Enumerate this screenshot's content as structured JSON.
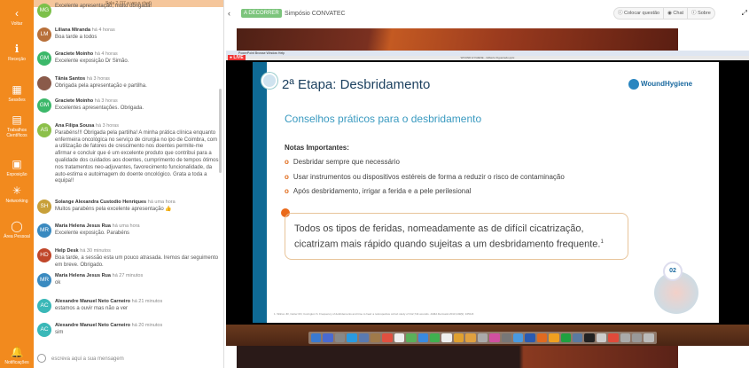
{
  "sidebar": {
    "items": [
      {
        "label": "Voltar",
        "icon": "chevron-left-icon"
      },
      {
        "label": "Receção",
        "icon": "info-icon"
      },
      {
        "label": "Sessões",
        "icon": "calendar-icon"
      },
      {
        "label": "Trabalhos Científicos",
        "icon": "documents-icon"
      },
      {
        "label": "Exposição",
        "icon": "booth-icon"
      },
      {
        "label": "Networking",
        "icon": "network-icon"
      },
      {
        "label": "Área Pessoal",
        "icon": "user-icon"
      },
      {
        "label": "Notificações",
        "icon": "bell-icon"
      }
    ]
  },
  "chat": {
    "room": "Sala 2 (37 a ver o chat)",
    "input_placeholder": "escreva aqui a sua mensagem",
    "messages": [
      {
        "initials": "MG",
        "name": "",
        "time": "",
        "text": "Excelente apresentação, muito obrigada!",
        "color": "#7cc04a"
      },
      {
        "initials": "LM",
        "name": "Liliana Miranda",
        "time": "há 4 horas",
        "text": "Boa tarde a todos",
        "color": "#b8703a"
      },
      {
        "initials": "GM",
        "name": "Graciete Moinho",
        "time": "há 4 horas",
        "text": "Excelente exposição Dr Simão.",
        "color": "#3cb86a"
      },
      {
        "initials": "",
        "name": "Tânia Santos",
        "time": "há 3 horas",
        "text": "Obrigada pela apresentação e partilha.",
        "color": "#8a5a4a"
      },
      {
        "initials": "GM",
        "name": "Graciete Moinho",
        "time": "há 3 horas",
        "text": "Excelentes apresentações. Obrigada.",
        "color": "#3cb86a"
      },
      {
        "initials": "AS",
        "name": "Ana Filipa Sousa",
        "time": "há 3 horas",
        "text": "Parabéns!!! Obrigada pela partilha! A minha prática clínica enquanto enfermeira oncológica no serviço de cirurgia no ipo de Coimbra, com a utilização de fatores de crescimento nos doentes permite-me afirmar e concluir que é um excelente produto que contribui para a qualidade dos cuidados aos doentes, cumprimento de tempos ótimos nos tratamentos neo-adjuvantes, favorecimento funcionalidade, da auto-estima e autoimagem do doente oncológico. Grata a toda a equipa!!",
        "color": "#8cc04a"
      },
      {
        "initials": "SH",
        "name": "Solange Alexandra Custodio Henriques",
        "time": "há uma hora",
        "text": "Muitos parabéns pela excelente apresentação 👍",
        "color": "#c8a03a"
      },
      {
        "initials": "MR",
        "name": "Maria Helena Jesus Rua",
        "time": "há uma hora",
        "text": "Excelente exposição. Parabéns",
        "color": "#3a8ac0"
      },
      {
        "initials": "HD",
        "name": "Help Desk",
        "time": "há 30 minutos",
        "text": "Boa tarde, a sessão esta um pouco atrasada. Iremos dar seguimento em breve. Obrigado.",
        "color": "#c0462a"
      },
      {
        "initials": "MR",
        "name": "Maria Helena Jesus Rua",
        "time": "há 27 minutos",
        "text": "ok",
        "color": "#3a8ac0"
      },
      {
        "initials": "AC",
        "name": "Alexandre Manuel Neto Carneiro",
        "time": "há 21 minutos",
        "text": "estamos a ouvir mas não a ver",
        "color": "#3ab8b8"
      },
      {
        "initials": "AC",
        "name": "Alexandre Manuel Neto Carneiro",
        "time": "há 20 minutos",
        "text": "sim",
        "color": "#3ab8b8"
      }
    ]
  },
  "header": {
    "status": "A DECORRER",
    "title": "Simpósio CONVATEC",
    "actions": [
      "Colocar questão",
      "Chat",
      "Sobre"
    ]
  },
  "stream": {
    "live": "LIVE",
    "menubar": "PowerPoint   Browse   Window   Help",
    "window_title": "WOUND HYGIENE - Gilberto Figueiredo.pptx",
    "slide": {
      "title": "2ª Etapa: Desbridamento",
      "logo": "WoundHygiene",
      "subtitle": "Conselhos práticos para o desbridamento",
      "notes_heading": "Notas Importantes:",
      "bullets": [
        "Desbridar sempre que necessário",
        "Usar instrumentos ou dispositivos estéreis de forma a reduzir o risco de contaminação",
        "Após desbridamento, irrigar a ferida e a pele perilesional"
      ],
      "callout": "Todos os tipos de feridas, nomeadamente as de difícil cicatrização, cicatrizam mais rápido quando sujeitas a um desbridamento frequente.",
      "callout_sup": "1",
      "step": "02",
      "reference": "1. Wilcox JR, Carter MJ, Covington S. Frequency of debridements and time to heal: a retrospective cohort study of 312,744 wounds. JAMA Dermatol 2013;149(9): 1050-8."
    }
  }
}
